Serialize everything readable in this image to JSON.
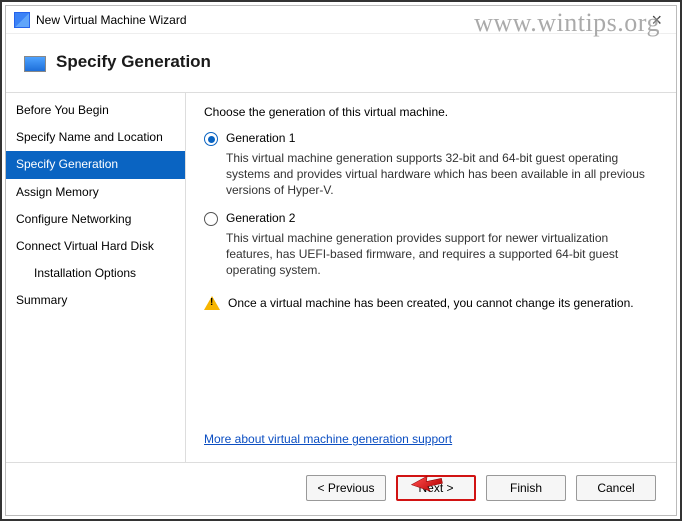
{
  "watermark": "www.wintips.org",
  "titlebar": {
    "title": "New Virtual Machine Wizard"
  },
  "header": {
    "title": "Specify Generation"
  },
  "sidebar": {
    "steps": [
      {
        "label": "Before You Begin",
        "selected": false,
        "indent": false
      },
      {
        "label": "Specify Name and Location",
        "selected": false,
        "indent": false
      },
      {
        "label": "Specify Generation",
        "selected": true,
        "indent": false
      },
      {
        "label": "Assign Memory",
        "selected": false,
        "indent": false
      },
      {
        "label": "Configure Networking",
        "selected": false,
        "indent": false
      },
      {
        "label": "Connect Virtual Hard Disk",
        "selected": false,
        "indent": false
      },
      {
        "label": "Installation Options",
        "selected": false,
        "indent": true
      },
      {
        "label": "Summary",
        "selected": false,
        "indent": false
      }
    ]
  },
  "main": {
    "intro": "Choose the generation of this virtual machine.",
    "options": [
      {
        "label": "Generation 1",
        "checked": true,
        "desc": "This virtual machine generation supports 32-bit and 64-bit guest operating systems and provides virtual hardware which has been available in all previous versions of Hyper-V."
      },
      {
        "label": "Generation 2",
        "checked": false,
        "desc": "This virtual machine generation provides support for newer virtualization features, has UEFI-based firmware, and requires a supported 64-bit guest operating system."
      }
    ],
    "warning": "Once a virtual machine has been created, you cannot change its generation.",
    "link": "More about virtual machine generation support"
  },
  "footer": {
    "previous": "< Previous",
    "next": "Next >",
    "finish": "Finish",
    "cancel": "Cancel"
  }
}
